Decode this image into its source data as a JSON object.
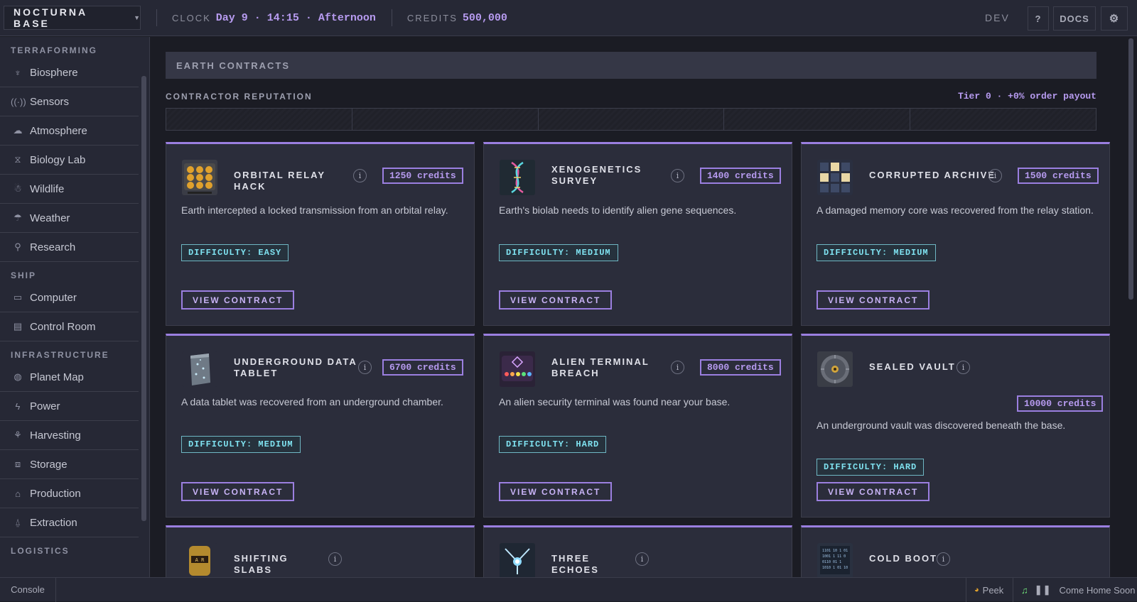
{
  "topbar": {
    "base_name": "NOCTURNA BASE",
    "clock_label": "CLOCK",
    "clock_value": "Day 9 · 14:15 · Afternoon",
    "credits_label": "CREDITS",
    "credits_value": "500,000",
    "dev_label": "DEV",
    "help_label": "?",
    "docs_label": "DOCS",
    "settings_icon": "gear-icon"
  },
  "sidebar": {
    "sections": [
      {
        "title": "TERRAFORMING",
        "items": [
          {
            "label": "Biosphere",
            "icon": "plant-icon"
          },
          {
            "label": "Sensors",
            "icon": "radar-icon"
          },
          {
            "label": "Atmosphere",
            "icon": "cloud-icon"
          },
          {
            "label": "Biology Lab",
            "icon": "dna-icon"
          },
          {
            "label": "Wildlife",
            "icon": "creature-icon"
          },
          {
            "label": "Weather",
            "icon": "wind-icon"
          },
          {
            "label": "Research",
            "icon": "magnifier-icon"
          }
        ]
      },
      {
        "title": "SHIP",
        "items": [
          {
            "label": "Computer",
            "icon": "monitor-icon"
          },
          {
            "label": "Control Room",
            "icon": "panel-icon"
          }
        ]
      },
      {
        "title": "INFRASTRUCTURE",
        "items": [
          {
            "label": "Planet Map",
            "icon": "globe-icon"
          },
          {
            "label": "Power",
            "icon": "bolt-icon"
          },
          {
            "label": "Harvesting",
            "icon": "sprout-icon"
          },
          {
            "label": "Storage",
            "icon": "boxes-icon"
          },
          {
            "label": "Production",
            "icon": "factory-icon"
          },
          {
            "label": "Extraction",
            "icon": "drill-icon"
          }
        ]
      },
      {
        "title": "LOGISTICS",
        "items": []
      }
    ]
  },
  "main": {
    "panel_title": "EARTH CONTRACTS",
    "reputation_label": "CONTRACTOR REPUTATION",
    "reputation_tier": "Tier 0 · +0% order payout",
    "reputation_fraction": 0,
    "cards": [
      {
        "title": "ORBITAL RELAY HACK",
        "credits": "1250 credits",
        "desc": "Earth intercepted a locked transmission from an orbital relay.",
        "difficulty": "DIFFICULTY: EASY",
        "button": "VIEW CONTRACT"
      },
      {
        "title": "XENOGENETICS SURVEY",
        "credits": "1400 credits",
        "desc": "Earth's biolab needs to identify alien gene sequences.",
        "difficulty": "DIFFICULTY: MEDIUM",
        "button": "VIEW CONTRACT"
      },
      {
        "title": "CORRUPTED ARCHIVE",
        "credits": "1500 credits",
        "desc": "A damaged memory core was recovered from the relay station.",
        "difficulty": "DIFFICULTY: MEDIUM",
        "button": "VIEW CONTRACT"
      },
      {
        "title": "UNDERGROUND DATA TABLET",
        "credits": "6700 credits",
        "desc": "A data tablet was recovered from an underground chamber.",
        "difficulty": "DIFFICULTY: MEDIUM",
        "button": "VIEW CONTRACT"
      },
      {
        "title": "ALIEN TERMINAL BREACH",
        "credits": "8000 credits",
        "desc": "An alien security terminal was found near your base.",
        "difficulty": "DIFFICULTY: HARD",
        "button": "VIEW CONTRACT"
      },
      {
        "title": "SEALED VAULT",
        "credits": "10000 credits",
        "desc": "An underground vault was discovered beneath the base.",
        "difficulty": "DIFFICULTY: HARD",
        "button": "VIEW CONTRACT"
      },
      {
        "title": "SHIFTING SLABS"
      },
      {
        "title": "THREE ECHOES"
      },
      {
        "title": "COLD BOOT"
      }
    ]
  },
  "bottombar": {
    "console_label": "Console",
    "peek_label": "Peek",
    "music_track": "Come Home Soon",
    "music_state": "playing"
  }
}
